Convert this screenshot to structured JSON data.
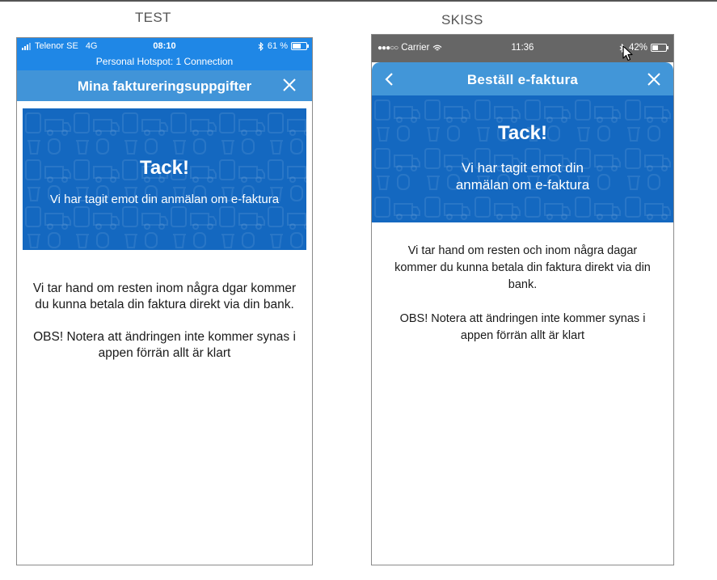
{
  "labels": {
    "test": "TEST",
    "skiss": "SKISS"
  },
  "test_phone": {
    "status": {
      "carrier": "Telenor SE",
      "network": "4G",
      "time": "08:10",
      "battery": "61 %",
      "battery_level": 0.61,
      "hotspot": "Personal Hotspot: 1 Connection",
      "bluetooth_icon": "bluetooth-icon"
    },
    "nav": {
      "title": "Mina faktureringsuppgifter",
      "close_icon": "close-icon"
    },
    "banner": {
      "title": "Tack!",
      "subtitle": "Vi har tagit emot din anmälan om e-faktura"
    },
    "body": {
      "paragraph1": "Vi tar hand om resten inom några dgar kommer du kunna betala din faktura direkt via din bank.",
      "paragraph2": "OBS! Notera att ändringen inte kommer synas i appen förrän allt är klart"
    }
  },
  "skiss_phone": {
    "status": {
      "carrier": "Carrier",
      "signal_dots": "●●●○○",
      "time": "11:36",
      "battery": "42%",
      "battery_level": 0.42,
      "wifi_icon": "wifi-icon",
      "bluetooth_icon": "bluetooth-icon"
    },
    "nav": {
      "title": "Beställ e-faktura",
      "back_icon": "chevron-left-icon",
      "close_icon": "close-icon"
    },
    "banner": {
      "title": "Tack!",
      "subtitle": "Vi har tagit emot din anmälan om e-faktura"
    },
    "body": {
      "paragraph1": "Vi tar hand om resten och inom några dagar kommer du kunna betala din faktura direkt via din bank.",
      "paragraph2": "OBS! Notera att ändringen inte kommer synas i appen förrän allt är klart"
    }
  },
  "colors": {
    "status_blue": "#1f87e6",
    "nav_blue": "#4194d8",
    "banner_blue": "#1468c0",
    "status_gray": "#666666"
  }
}
